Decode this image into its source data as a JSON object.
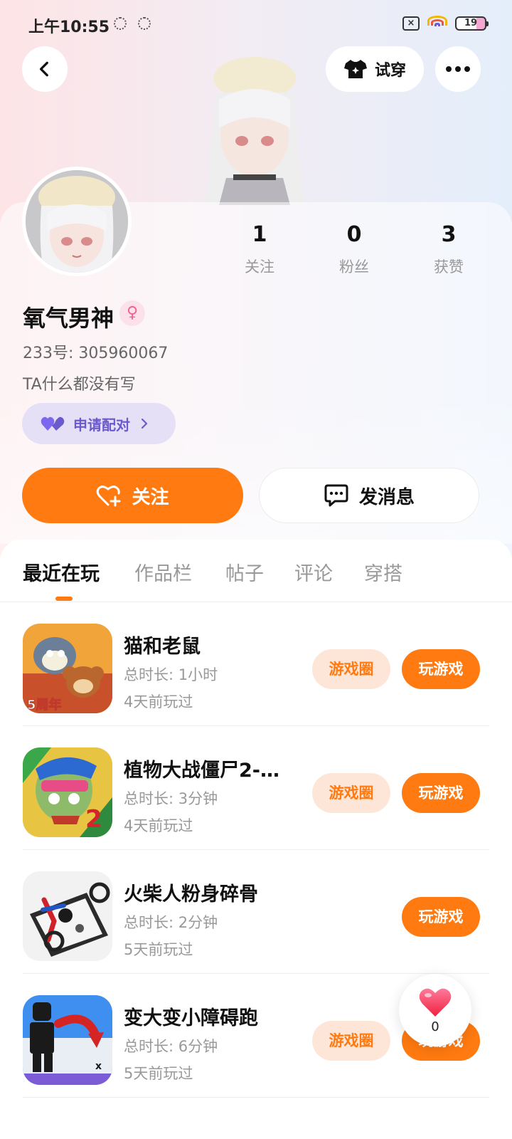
{
  "status_bar": {
    "time": "上午10:55",
    "battery": "19"
  },
  "nav": {
    "tryon_label": "试穿"
  },
  "profile": {
    "stats": [
      {
        "value": "1",
        "label": "关注"
      },
      {
        "value": "0",
        "label": "粉丝"
      },
      {
        "value": "3",
        "label": "获赞"
      }
    ],
    "nickname": "氧气男神",
    "gender_symbol": "♀",
    "uid": "233号: 305960067",
    "bio": "TA什么都没有写",
    "pair_label": "申请配对",
    "follow_label": "关注",
    "message_label": "发消息"
  },
  "tabs": [
    {
      "label": "最近在玩",
      "active": true
    },
    {
      "label": "作品栏",
      "active": false
    },
    {
      "label": "帖子",
      "active": false
    },
    {
      "label": "评论",
      "active": false
    },
    {
      "label": "穿搭",
      "active": false
    }
  ],
  "games": [
    {
      "name": "猫和老鼠",
      "duration": "总时长: 1小时",
      "last_played": "4天前玩过",
      "circle_label": "游戏圈",
      "play_label": "玩游戏",
      "icon": "tom-and-jerry-icon"
    },
    {
      "name": "植物大战僵尸2-…",
      "duration": "总时长: 3分钟",
      "last_played": "4天前玩过",
      "circle_label": "游戏圈",
      "play_label": "玩游戏",
      "icon": "pvz-icon"
    },
    {
      "name": "火柴人粉身碎骨",
      "duration": "总时长: 2分钟",
      "last_played": "5天前玩过",
      "circle_label": "",
      "play_label": "玩游戏",
      "icon": "stickman-icon"
    },
    {
      "name": "变大变小障碍跑",
      "duration": "总时长: 6分钟",
      "last_played": "5天前玩过",
      "circle_label": "游戏圈",
      "play_label": "玩游戏",
      "icon": "obstacle-run-icon"
    }
  ],
  "like_fab": {
    "count": "0"
  },
  "colors": {
    "accent": "#ff7a10",
    "accent_soft": "#fde6d8",
    "pair_bg": "#e6e0f7",
    "pair_text": "#6a5acd"
  }
}
